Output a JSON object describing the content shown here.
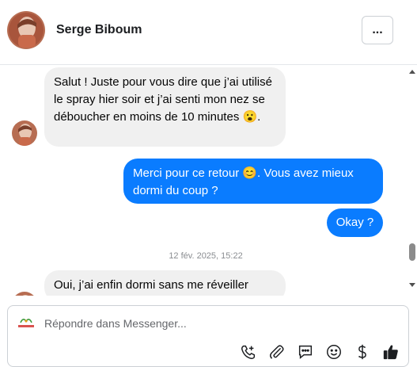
{
  "header": {
    "contact_name": "Serge Biboum",
    "avatar_icon": "contact-avatar",
    "more_label": "..."
  },
  "messages": [
    {
      "direction": "in",
      "text": "Salut ! Juste pour vous dire que j’ai utilisé le spray hier soir et j’ai senti mon nez se déboucher en moins de 10 minutes 😮."
    },
    {
      "direction": "out",
      "text": "Merci pour ce retour 😊. Vous avez mieux dormi du coup ?"
    },
    {
      "direction": "out",
      "text": "Okay ?"
    },
    {
      "direction": "in",
      "text": "Oui, j’ai enfin dormi sans me réveiller"
    }
  ],
  "timestamp": "12 fév. 2025, 15:22",
  "composer": {
    "placeholder": "Répondre dans Messenger...",
    "page_logo_icon": "page-logo",
    "tools": [
      "add-contact-icon",
      "attachment-icon",
      "chat-bubble-icon",
      "emoji-icon",
      "dollar-icon",
      "thumbs-up-icon"
    ]
  },
  "colors": {
    "outgoing_bubble": "#0a7cff",
    "incoming_bubble": "#f0f0f0",
    "timestamp": "#8a8d91"
  }
}
